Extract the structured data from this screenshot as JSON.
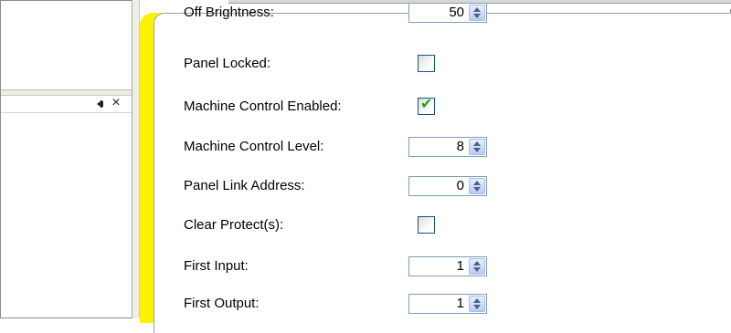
{
  "left_pane": {
    "pin_icon": "pin-icon",
    "close_icon": "close-icon",
    "close_glyph": "×"
  },
  "properties": [
    {
      "label": "Off Brightness:",
      "type": "spinner",
      "value": "50"
    },
    {
      "label": "Panel Locked:",
      "type": "checkbox",
      "checked": false
    },
    {
      "label": "Machine Control Enabled:",
      "type": "checkbox",
      "checked": true
    },
    {
      "label": "Machine Control Level:",
      "type": "spinner",
      "value": "8"
    },
    {
      "label": "Panel Link Address:",
      "type": "spinner",
      "value": "0"
    },
    {
      "label": "Clear Protect(s):",
      "type": "checkbox",
      "checked": false
    },
    {
      "label": "First Input:",
      "type": "spinner",
      "value": "1"
    },
    {
      "label": "First Output:",
      "type": "spinner",
      "value": "1"
    }
  ],
  "colors": {
    "highlight": "#fff200",
    "check": "#21a121",
    "spinner_border": "#7f9db9"
  }
}
